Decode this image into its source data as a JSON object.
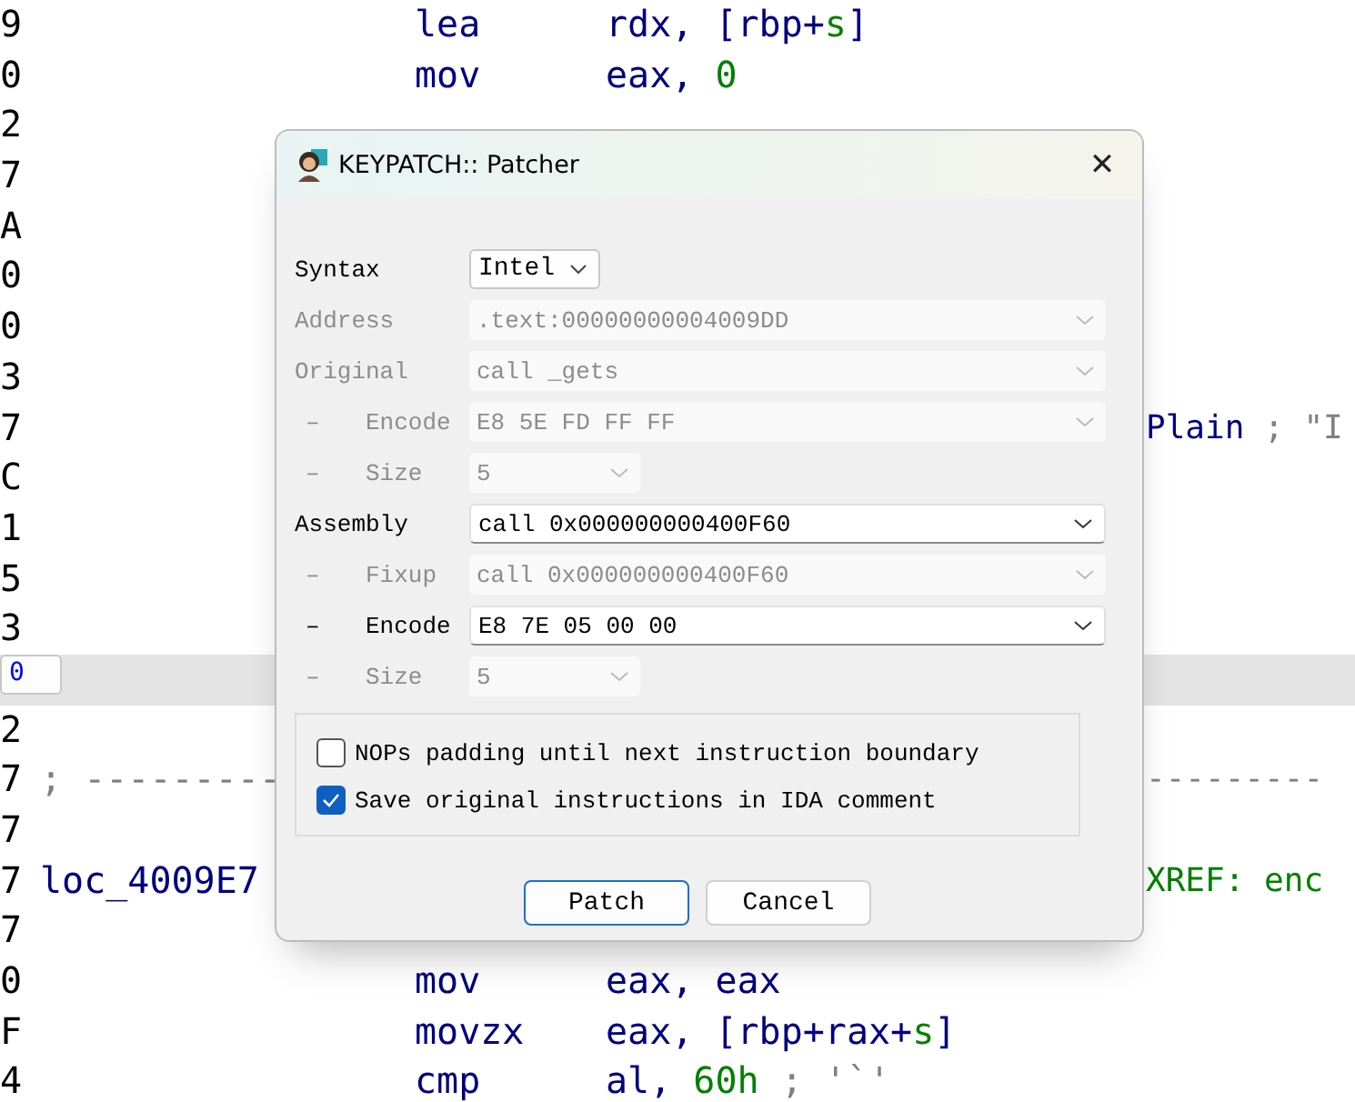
{
  "listing": {
    "lines": [
      {
        "addr": "9",
        "selected": false,
        "mnemonic": "lea",
        "operands": [
          {
            "text": "rdx, [rbp+",
            "kind": "plain"
          },
          {
            "text": "s",
            "kind": "var"
          },
          {
            "text": "]",
            "kind": "plain"
          }
        ]
      },
      {
        "addr": "0",
        "selected": false,
        "mnemonic": "mov",
        "operands": [
          {
            "text": "eax, ",
            "kind": "plain"
          },
          {
            "text": "0",
            "kind": "num"
          }
        ]
      },
      {
        "addr": "2",
        "selected": false
      },
      {
        "addr": "7",
        "selected": false
      },
      {
        "addr": "A",
        "selected": false
      },
      {
        "addr": "0",
        "selected": false
      },
      {
        "addr": "0",
        "selected": false
      },
      {
        "addr": "3",
        "selected": false
      },
      {
        "addr": "7",
        "selected": false,
        "right": [
          {
            "text": "Plain",
            "kind": "plain"
          },
          {
            "text": " ; \"I",
            "kind": "comment"
          }
        ]
      },
      {
        "addr": "C",
        "selected": false
      },
      {
        "addr": "1",
        "selected": false
      },
      {
        "addr": "5",
        "selected": false
      },
      {
        "addr": "3",
        "selected": false
      },
      {
        "addr": "0",
        "selected": true
      },
      {
        "addr": "2",
        "selected": false
      },
      {
        "addr": "7",
        "selected": false,
        "lead": [
          {
            "text": "; ---------",
            "kind": "comment"
          }
        ],
        "right": [
          {
            "text": "---------",
            "kind": "comment"
          }
        ]
      },
      {
        "addr": "7",
        "selected": false
      },
      {
        "addr": "7",
        "selected": false,
        "lead": [
          {
            "text": "loc_4009E7",
            "kind": "plain"
          }
        ],
        "right": [
          {
            "text": "XREF: enc",
            "kind": "xref"
          }
        ]
      },
      {
        "addr": "7",
        "selected": false
      },
      {
        "addr": "0",
        "selected": false,
        "mnemonic": "mov",
        "operands": [
          {
            "text": "eax, eax",
            "kind": "plain"
          }
        ]
      },
      {
        "addr": "F",
        "selected": false,
        "mnemonic": "movzx",
        "operands": [
          {
            "text": "eax, [rbp+rax+",
            "kind": "plain"
          },
          {
            "text": "s",
            "kind": "var"
          },
          {
            "text": "]",
            "kind": "plain"
          }
        ]
      },
      {
        "addr": "4",
        "selected": false,
        "mnemonic": "cmp",
        "operands": [
          {
            "text": "al, ",
            "kind": "plain"
          },
          {
            "text": "60h",
            "kind": "num"
          },
          {
            "text": " ; '`'",
            "kind": "comment"
          }
        ]
      }
    ]
  },
  "dialog": {
    "title": "KEYPATCH:: Patcher",
    "close": "✕",
    "rows": [
      {
        "label": "Syntax",
        "kind": "select",
        "value": "Intel",
        "disabled": false
      },
      {
        "label": "Address",
        "kind": "combo",
        "value": ".text:00000000004009DD",
        "disabled": true
      },
      {
        "label": "Original",
        "kind": "combo",
        "value": "call _gets",
        "disabled": true
      },
      {
        "prefix": "–",
        "label": "Encode",
        "kind": "combo",
        "value": "E8 5E FD FF FF",
        "disabled": true
      },
      {
        "prefix": "–",
        "label": "Size",
        "kind": "short",
        "value": "5",
        "disabled": true
      },
      {
        "label": "Assembly",
        "kind": "combo",
        "value": "call 0x000000000400F60",
        "disabled": false
      },
      {
        "prefix": "–",
        "label": "Fixup",
        "kind": "combo",
        "value": "call 0x000000000400F60",
        "disabled": true
      },
      {
        "prefix": "–",
        "label": "Encode",
        "kind": "combo",
        "value": "E8 7E 05 00 00",
        "disabled": false
      },
      {
        "prefix": "–",
        "label": "Size",
        "kind": "short",
        "value": "5",
        "disabled": true
      }
    ],
    "options": [
      {
        "label": "NOPs padding until next instruction boundary",
        "checked": false
      },
      {
        "label": "Save original instructions in IDA comment",
        "checked": true
      }
    ],
    "buttons": [
      {
        "label": "Patch",
        "default": true
      },
      {
        "label": "Cancel",
        "default": false
      }
    ]
  }
}
